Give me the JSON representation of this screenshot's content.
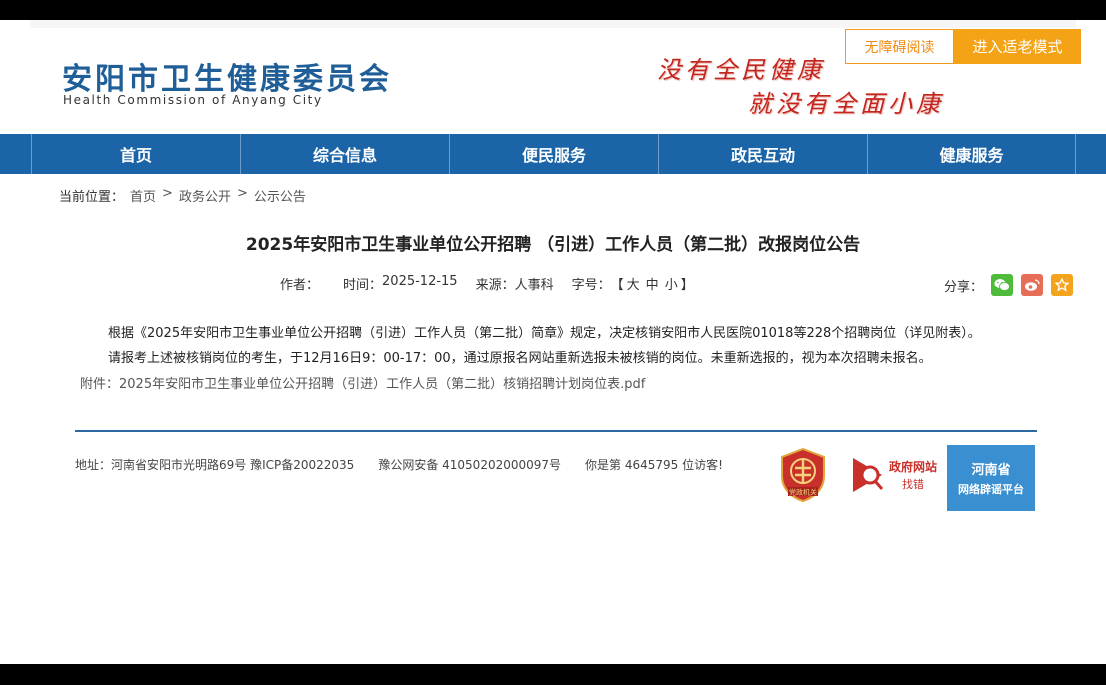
{
  "header": {
    "logo_cn": "安阳市卫生健康委员会",
    "logo_en": "Health Commission of Anyang City",
    "slogan_line1": "没有全民健康",
    "slogan_line2": "就没有全面小康",
    "accessibility_button": "无障碍阅读",
    "elder_mode_button": "进入适老模式",
    "accent_color": "#1a64a7",
    "slogan_color": "#c4261d",
    "button_color": "#f5a316"
  },
  "nav": {
    "items": [
      {
        "label": "首页"
      },
      {
        "label": "综合信息"
      },
      {
        "label": "便民服务"
      },
      {
        "label": "政民互动"
      },
      {
        "label": "健康服务"
      }
    ]
  },
  "breadcrumb": {
    "prefix": "当前位置：",
    "items": [
      "首页",
      "政务公开",
      "公示公告"
    ],
    "separator": ">"
  },
  "article": {
    "title": "2025年安阳市卫生事业单位公开招聘 （引进）工作人员（第二批）改报岗位公告",
    "author_label": "作者：",
    "time_label": "时间：",
    "time_value": "2025-12-15",
    "source_label": "来源：",
    "source_value": "人事科",
    "fontsize_label": "字号：",
    "fontsize_open": "【",
    "fontsize_options": [
      "大",
      "中",
      "小"
    ],
    "fontsize_close": "】",
    "share_label": "分享：",
    "paragraph1": "根据《2025年安阳市卫生事业单位公开招聘（引进）工作人员（第二批）简章》规定，决定核销安阳市人民医院01018等228个招聘岗位（详见附表）。",
    "paragraph2": "请报考上述被核销岗位的考生，于12月16日9：00-17：00，通过原报名网站重新选报未被核销的岗位。未重新选报的，视为本次招聘未报名。",
    "attachment_label": "附件：",
    "attachment_name": "2025年安阳市卫生事业单位公开招聘（引进）工作人员（第二批）核销招聘计划岗位表.pdf"
  },
  "footer": {
    "address": "地址：河南省安阳市光明路69号 豫ICP备20022035",
    "police": "豫公网安备 41050202000097号",
    "visitors": "你是第 4645795 位访客!",
    "party_badge_text": "党政机关",
    "error_badge_line1": "政府网站",
    "error_badge_line2": "找错",
    "rumor_line1": "河南省",
    "rumor_line2": "网络辟谣平台"
  }
}
